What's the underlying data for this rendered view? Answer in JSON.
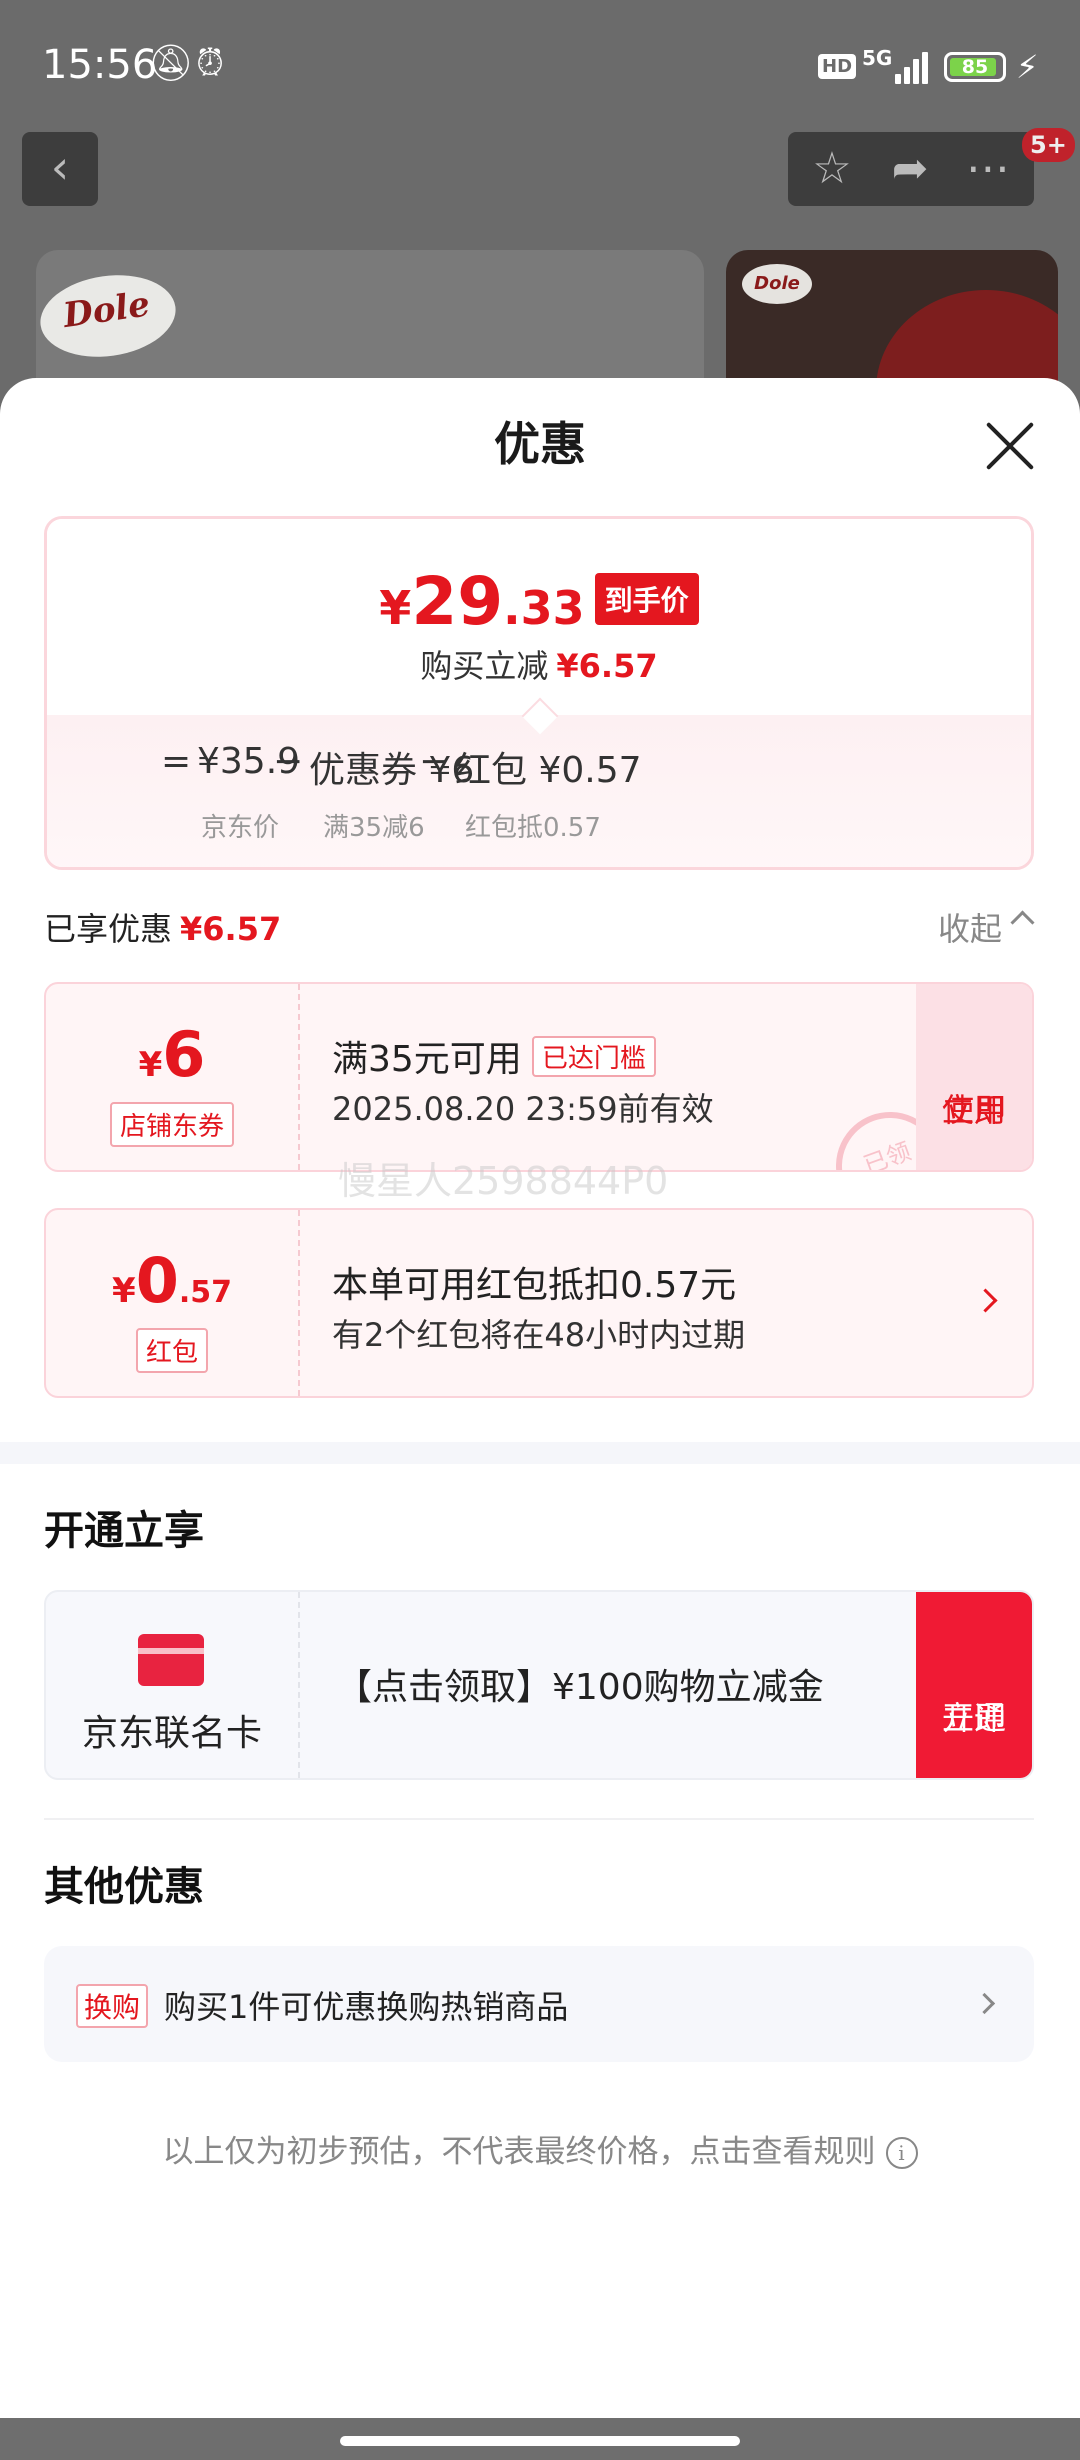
{
  "status_bar": {
    "time": "15:56",
    "hd": "HD",
    "network": "5G",
    "battery": "85"
  },
  "header": {
    "notification_badge": "5+"
  },
  "sheet": {
    "title": "优惠",
    "price": {
      "currency": "¥",
      "integer": "29",
      "decimal": ".33",
      "final_tag": "到手价",
      "instant_cut_label": "购买立减",
      "instant_cut_value": "¥6.57",
      "formula": {
        "equals": "=",
        "base": "¥35.9",
        "minus1": "−",
        "coupon": "优惠券 ¥6",
        "minus2": "−",
        "redpacket": "红包 ¥0.57",
        "base_label": "京东价",
        "coupon_label": "满35减6",
        "redpacket_label": "红包抵0.57"
      }
    },
    "enjoyed": {
      "label": "已享优惠",
      "value": "¥6.57",
      "collapse": "收起"
    },
    "coupons": [
      {
        "currency": "¥",
        "amount": "6",
        "type": "店铺东券",
        "main": "满35元可用",
        "threshold_tag": "已达门槛",
        "sub": "2025.08.20 23:59前有效",
        "button_line1": "立即",
        "button_line2": "使用",
        "stamp": "已领"
      },
      {
        "currency": "¥",
        "amount": "0",
        "decimal": ".57",
        "type": "红包",
        "main": "本单可用红包抵扣0.57元",
        "sub": "有2个红包将在48小时内过期"
      }
    ],
    "watermark": "慢星人2598844P0",
    "open_section": {
      "title": "开通立享",
      "card_name": "京东联名卡",
      "promo": "【点击领取】¥100购物立减金",
      "button_line1": "立即",
      "button_line2": "开通"
    },
    "other_section": {
      "title": "其他优惠",
      "tag": "换购",
      "text": "购买1件可优惠换购热销商品"
    },
    "disclaimer": "以上仅为初步预估，不代表最终价格，点击查看规则",
    "info_symbol": "i"
  },
  "colors": {
    "accent": "#e4171f",
    "open_button": "#f01a34",
    "coupon_bg": "#fff5f6"
  }
}
